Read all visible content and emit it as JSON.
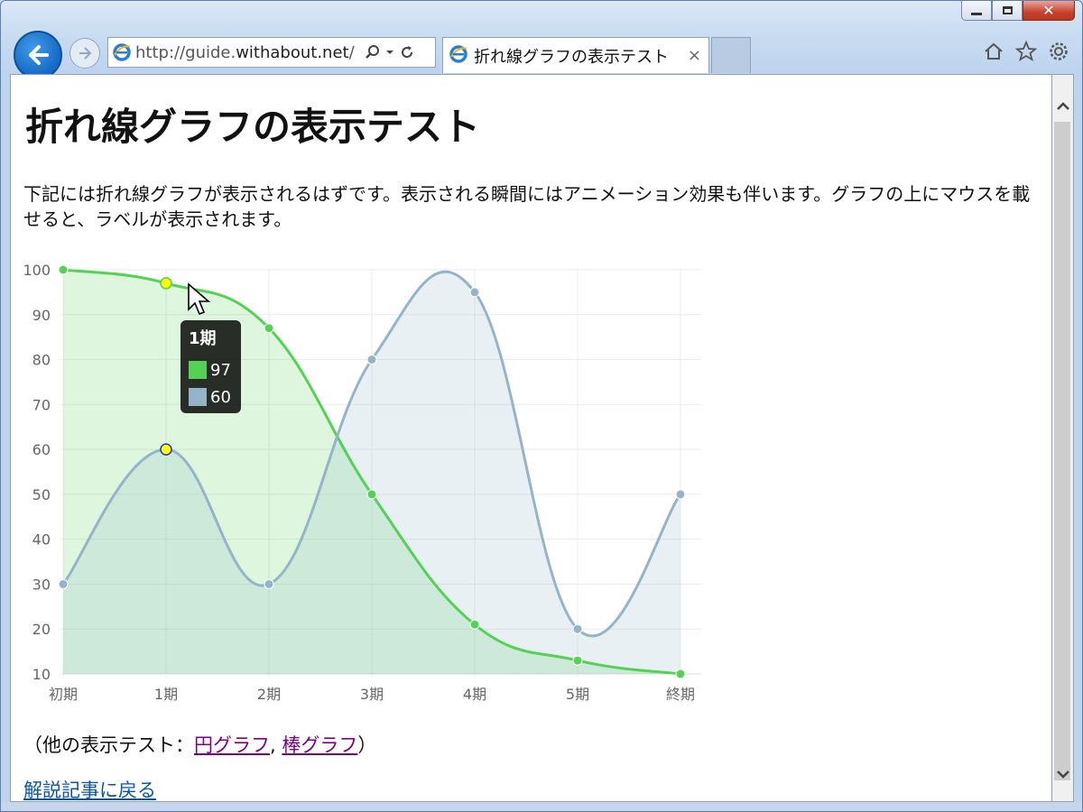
{
  "browser": {
    "url_prefix": "http://guide.",
    "url_domain": "withabout.net",
    "url_suffix": "/",
    "tab_title": "折れ線グラフの表示テスト",
    "tab_close": "×",
    "close_glyph": "✕"
  },
  "page": {
    "heading": "折れ線グラフの表示テスト",
    "description": "下記には折れ線グラフが表示されるはずです。表示される瞬間にはアニメーション効果も伴います。グラフの上にマウスを載せると、ラベルが表示されます。",
    "others_prefix": "（他の表示テスト：",
    "link_pie": "円グラフ",
    "separator": ",",
    "link_bar": "棒グラフ",
    "others_suffix": "）",
    "back_link": "解説記事に戻る"
  },
  "tooltip": {
    "title": "1期",
    "value1": "97",
    "value2": "60"
  },
  "chart_data": {
    "type": "line",
    "categories": [
      "初期",
      "1期",
      "2期",
      "3期",
      "4期",
      "5期",
      "終期"
    ],
    "series": [
      {
        "values": [
          100,
          97,
          87,
          50,
          21,
          13,
          10
        ],
        "color": "#55d155",
        "fill": "rgba(120,220,120,0.25)"
      },
      {
        "values": [
          30,
          60,
          30,
          80,
          95,
          20,
          50
        ],
        "color": "#96b4c8",
        "fill": "rgba(151,187,205,0.22)"
      }
    ],
    "yticks": [
      100,
      90,
      80,
      70,
      60,
      50,
      40,
      30,
      20,
      10
    ],
    "ylim": [
      10,
      100
    ],
    "grid": true,
    "highlighted_index": 1,
    "highlight_color": "#ffff00"
  }
}
